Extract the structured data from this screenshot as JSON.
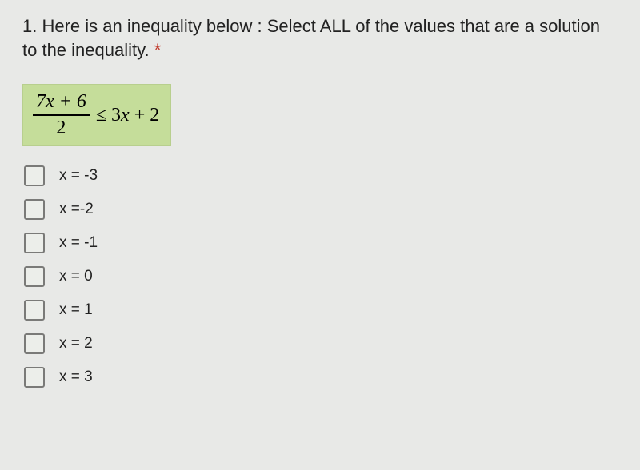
{
  "question": {
    "number": "1.",
    "text": "Here is an inequality below : Select ALL of the values that are a solution to the inequality.",
    "required_marker": "*"
  },
  "inequality": {
    "lhs_numerator": "7x + 6",
    "lhs_denominator": "2",
    "operator": "≤",
    "rhs": "3x + 2"
  },
  "options": [
    {
      "label": "x = -3",
      "checked": false
    },
    {
      "label": "x =-2",
      "checked": false
    },
    {
      "label": "x = -1",
      "checked": false
    },
    {
      "label": "x = 0",
      "checked": false
    },
    {
      "label": "x = 1",
      "checked": false
    },
    {
      "label": "x = 2",
      "checked": false
    },
    {
      "label": "x = 3",
      "checked": false
    }
  ]
}
